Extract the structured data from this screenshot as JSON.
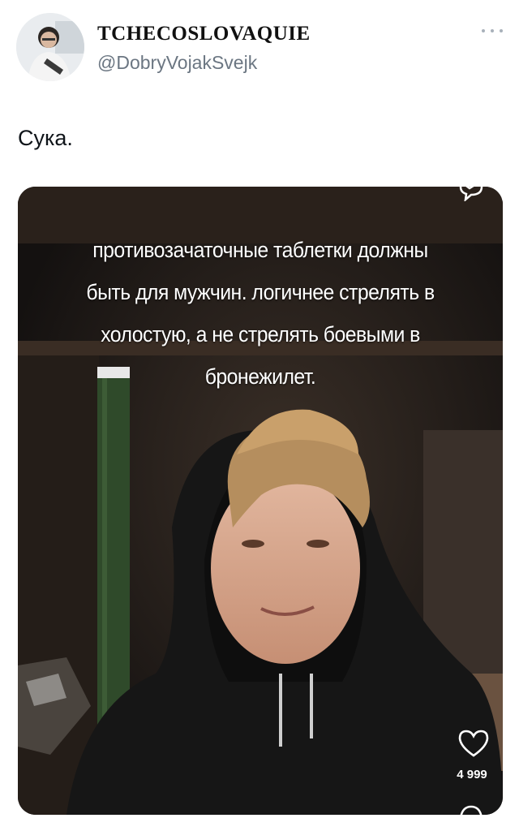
{
  "author": {
    "display_name": "TCHECOSLOVAQUIE",
    "handle": "@DobryVojakSvejk",
    "avatar_icon": "user-avatar"
  },
  "tweet": {
    "text": "Сука."
  },
  "video": {
    "caption_lines": [
      "противозачаточные таблетки должны",
      "быть для мужчин. логичнее стрелять в",
      "холостую, а не стрелять боевыми в",
      "бронежилет."
    ],
    "like_count": "4 999",
    "icons": [
      "comment-icon",
      "heart-icon",
      "share-icon"
    ]
  },
  "colors": {
    "handle": "#6b7682",
    "text": "#0f1419",
    "media_bg": "#1b1714"
  }
}
